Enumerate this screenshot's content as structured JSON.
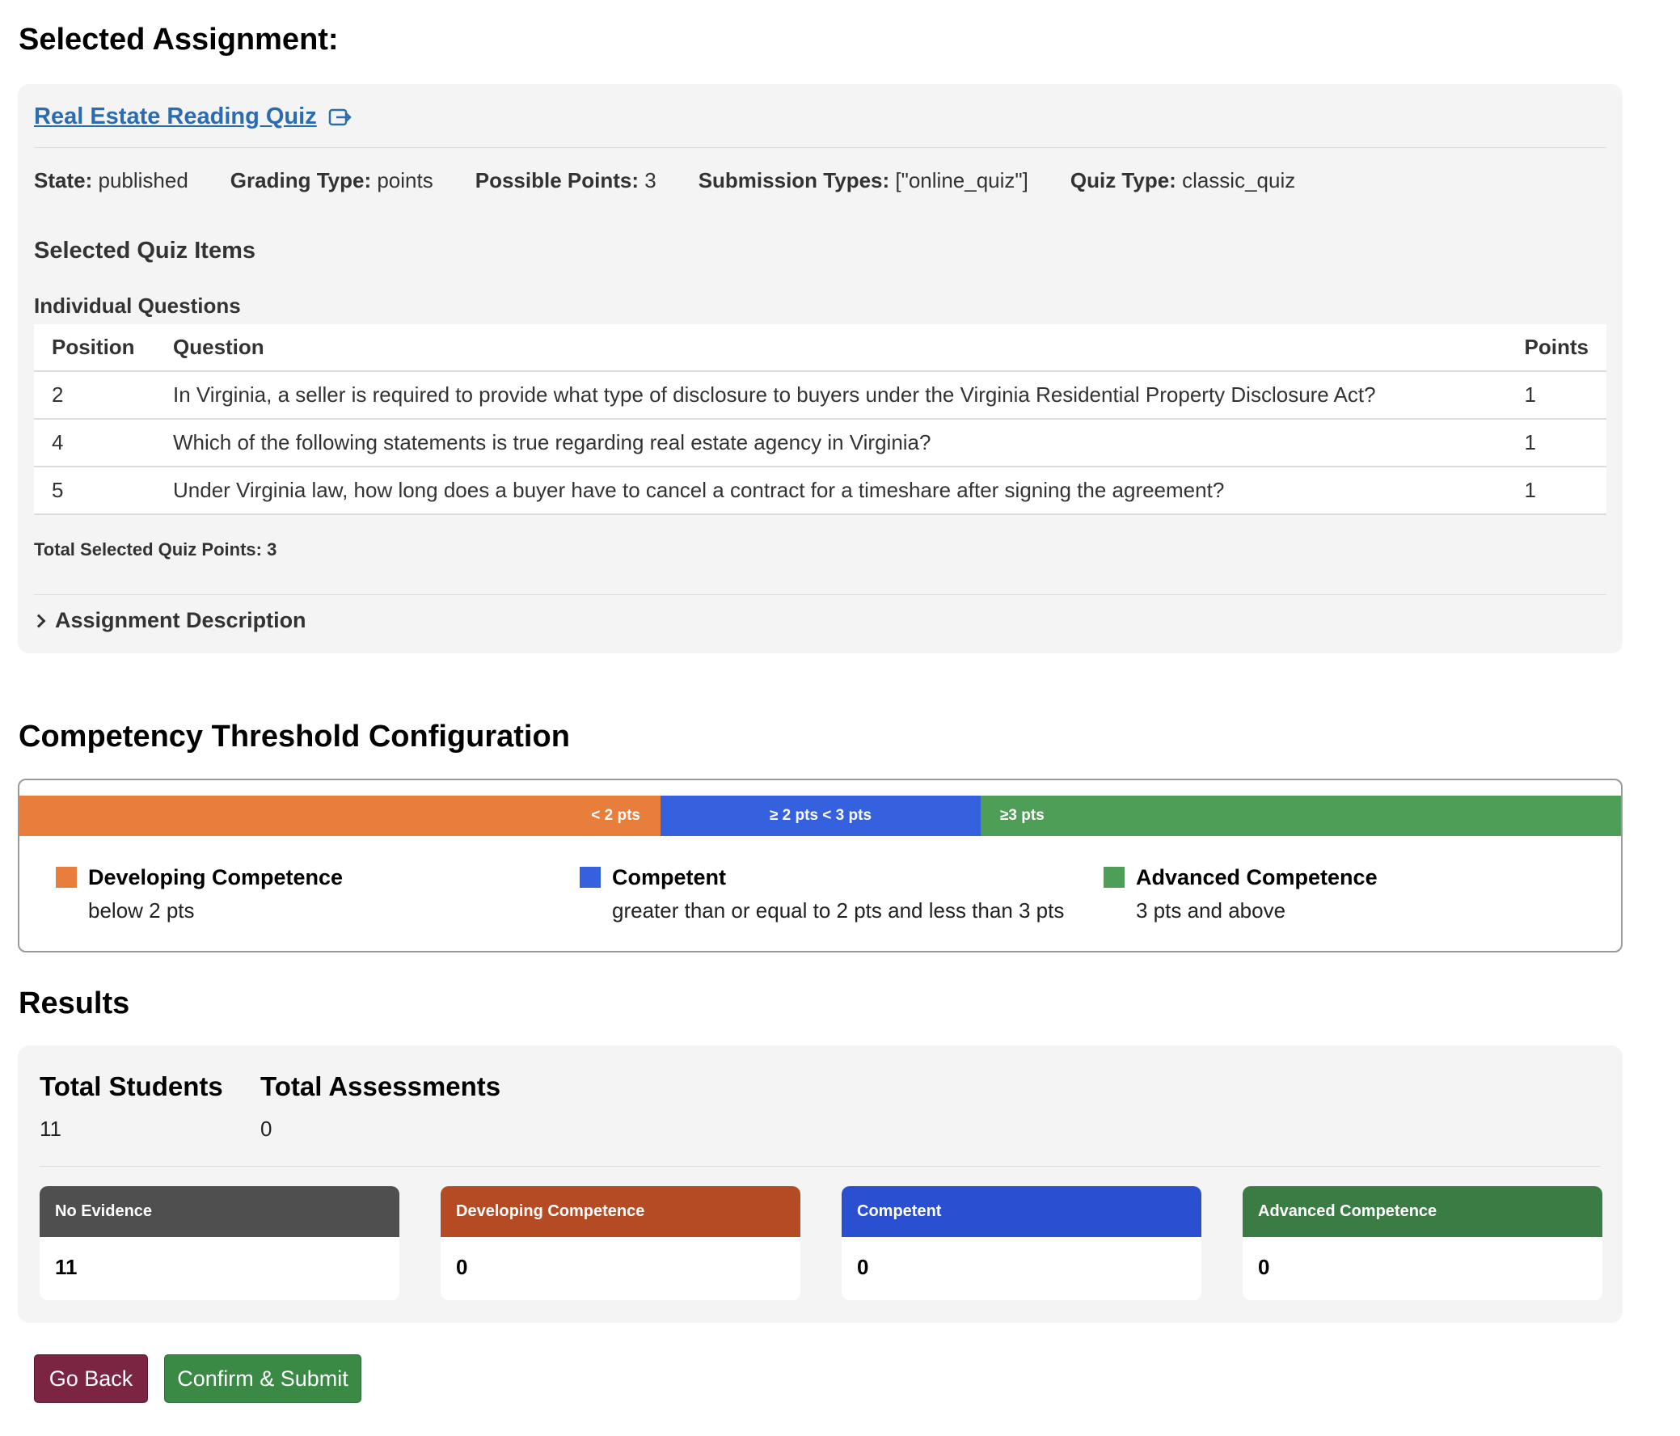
{
  "selected_heading": "Selected Assignment:",
  "assignment": {
    "title": "Real Estate Reading Quiz",
    "meta": [
      {
        "label": "State:",
        "value": "published"
      },
      {
        "label": "Grading Type:",
        "value": "points"
      },
      {
        "label": "Possible Points:",
        "value": "3"
      },
      {
        "label": "Submission Types:",
        "value": "[\"online_quiz\"]"
      },
      {
        "label": "Quiz Type:",
        "value": "classic_quiz"
      }
    ],
    "quiz_items_heading": "Selected Quiz Items",
    "individual_heading": "Individual Questions",
    "columns": [
      "Position",
      "Question",
      "Points"
    ],
    "rows": [
      {
        "position": "2",
        "question": "In Virginia, a seller is required to provide what type of disclosure to buyers under the Virginia Residential Property Disclosure Act?",
        "points": "1"
      },
      {
        "position": "4",
        "question": "Which of the following statements is true regarding real estate agency in Virginia?",
        "points": "1"
      },
      {
        "position": "5",
        "question": "Under Virginia law, how long does a buyer have to cancel a contract for a timeshare after signing the agreement?",
        "points": "1"
      }
    ],
    "total_points": "Total Selected Quiz Points: 3",
    "description_toggle": "Assignment Description"
  },
  "threshold": {
    "heading": "Competency Threshold Configuration",
    "bar": {
      "developing_label": "< 2 pts",
      "competent_label": "≥ 2 pts < 3 pts",
      "advanced_label": "≥3 pts"
    },
    "legend": [
      {
        "title": "Developing Competence",
        "desc": "below 2 pts",
        "color": "#e87e3b"
      },
      {
        "title": "Competent",
        "desc": "greater than or equal to 2 pts and less than 3 pts",
        "color": "#3561df"
      },
      {
        "title": "Advanced Competence",
        "desc": "3 pts and above",
        "color": "#4f9e57"
      }
    ]
  },
  "results": {
    "heading": "Results",
    "total_students_label": "Total Students",
    "total_students": "11",
    "total_assessments_label": "Total Assessments",
    "total_assessments": "0",
    "cards": [
      {
        "label": "No Evidence",
        "value": "11",
        "color": "#4f4f4f"
      },
      {
        "label": "Developing Competence",
        "value": "0",
        "color": "#b54b24"
      },
      {
        "label": "Competent",
        "value": "0",
        "color": "#2b4fd1"
      },
      {
        "label": "Advanced Competence",
        "value": "0",
        "color": "#3b7c45"
      }
    ]
  },
  "buttons": {
    "back": "Go Back",
    "submit": "Confirm & Submit"
  }
}
